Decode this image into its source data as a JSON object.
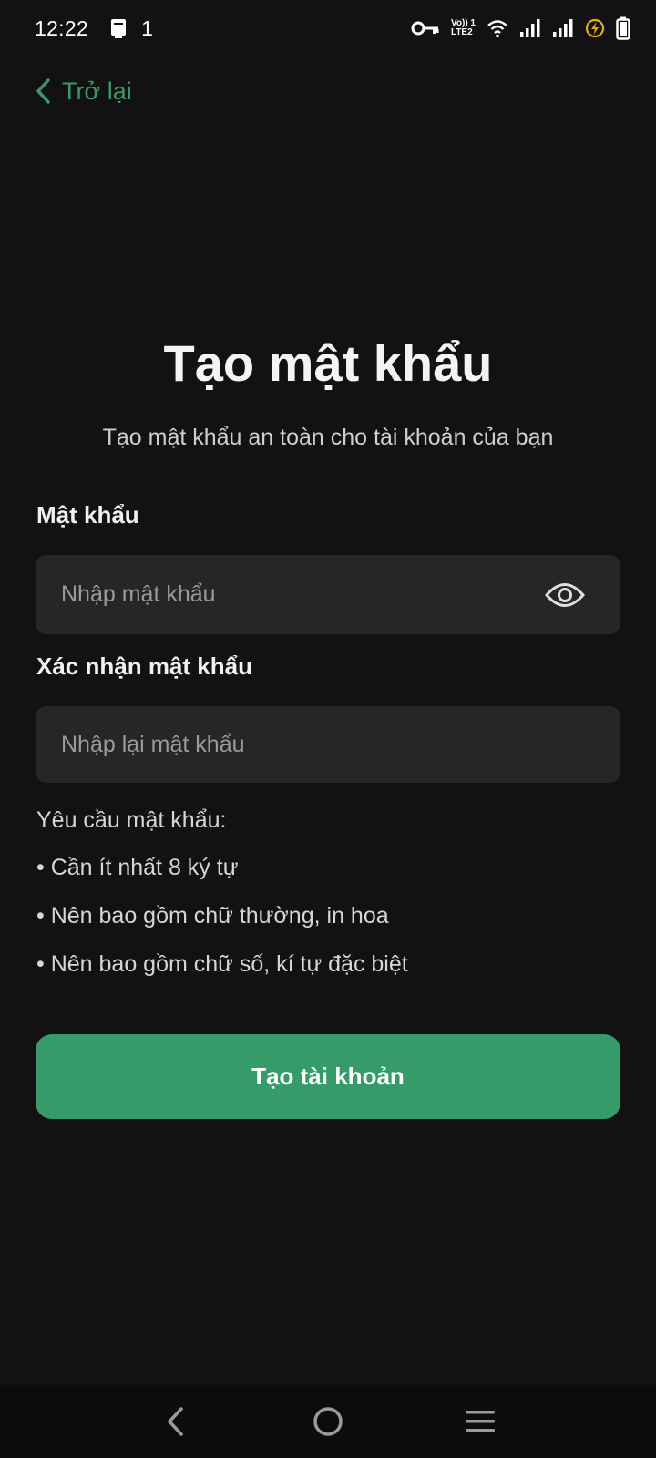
{
  "status_bar": {
    "time": "12:22",
    "notif_count": "1",
    "volte": "Vo)) 1",
    "lte": "LTE2",
    "icons": [
      "clipboard-icon",
      "key-icon",
      "wifi-icon",
      "signal-icon",
      "signal-icon",
      "charging-icon",
      "battery-icon"
    ]
  },
  "header": {
    "back_label": "Trở lại"
  },
  "main": {
    "title": "Tạo mật khẩu",
    "subtitle": "Tạo mật khẩu an toàn cho tài khoản của bạn",
    "password": {
      "label": "Mật khẩu",
      "placeholder": "Nhập mật khẩu",
      "value": ""
    },
    "confirm": {
      "label": "Xác nhận mật khẩu",
      "placeholder": "Nhập lại mật khẩu",
      "value": ""
    },
    "requirements": {
      "title": "Yêu cầu mật khẩu:",
      "items": [
        "Cần ít nhất 8 ký tự",
        "Nên bao gồm chữ thường, in hoa",
        "Nên bao gồm chữ số, kí tự đặc biệt"
      ]
    },
    "submit_label": "Tạo tài khoản"
  },
  "colors": {
    "background": "#121212",
    "accent": "#359b68",
    "input_bg": "#262626"
  }
}
